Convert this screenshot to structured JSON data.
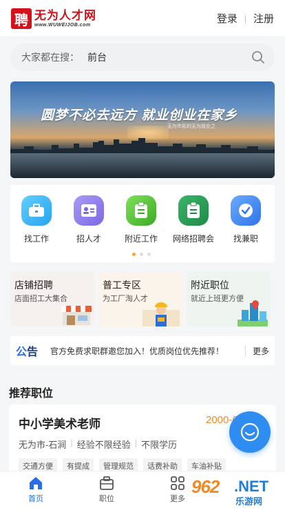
{
  "header": {
    "logo_mark": "聘",
    "logo_title": "无为人才网",
    "logo_url": "www.WUWEIJOB.com",
    "login_label": "登录",
    "separator": "|",
    "register_label": "注册"
  },
  "search": {
    "label": "大家都在搜：",
    "value": "前台",
    "icon": "search-icon"
  },
  "banner": {
    "slogan": "圆梦不必去远方 就业创业在家乡",
    "sub": "无为市民的无为就业之"
  },
  "quick_links": [
    {
      "label": "找工作",
      "icon": "briefcase-icon",
      "color": "#3ab4f7"
    },
    {
      "label": "招人才",
      "icon": "id-card-icon",
      "color": "#8b7bea"
    },
    {
      "label": "附近工作",
      "icon": "document-icon",
      "color": "#58c23a"
    },
    {
      "label": "网络招聘会",
      "icon": "document-icon",
      "color": "#2a9d55"
    },
    {
      "label": "找兼职",
      "icon": "clock-check-icon",
      "color": "#3a86f5"
    }
  ],
  "pager": {
    "active": 0,
    "count": 3
  },
  "feature_cards": [
    {
      "title": "店铺招聘",
      "subtitle": "店面招工大集合",
      "bg": "#f6f1ee"
    },
    {
      "title": "普工专区",
      "subtitle": "为工厂淘人才",
      "bg": "#fbf4ea"
    },
    {
      "title": "附近职位",
      "subtitle": "就近上班更方便",
      "bg": "#eef5f1"
    }
  ],
  "notice": {
    "tag_a": "公",
    "tag_b": "告",
    "message": "官方免费求职群邀您加入！优质岗位优先推荐！",
    "more": "更多"
  },
  "recommend": {
    "title": "推荐职位",
    "job": {
      "title": "中小学美术老师",
      "salary": "2000-6",
      "location": "无为市-石涧",
      "experience": "经验不限经验",
      "education": "不限学历",
      "meta_sep": "|",
      "tags": [
        "交通方便",
        "有提成",
        "管理规范",
        "话费补助",
        "车油补贴"
      ]
    }
  },
  "tabbar": {
    "items": [
      {
        "label": "首页",
        "icon": "home-icon",
        "active": true
      },
      {
        "label": "职位",
        "icon": "briefcase-icon",
        "active": false
      },
      {
        "label": "更多",
        "icon": "grid-icon",
        "active": false
      }
    ]
  },
  "watermark": {
    "num": "962",
    "net": ".NET",
    "cn": "乐游网"
  },
  "colors": {
    "brand_red": "#d4121b",
    "accent_blue": "#2b6de8",
    "salary_orange": "#f08a24"
  }
}
